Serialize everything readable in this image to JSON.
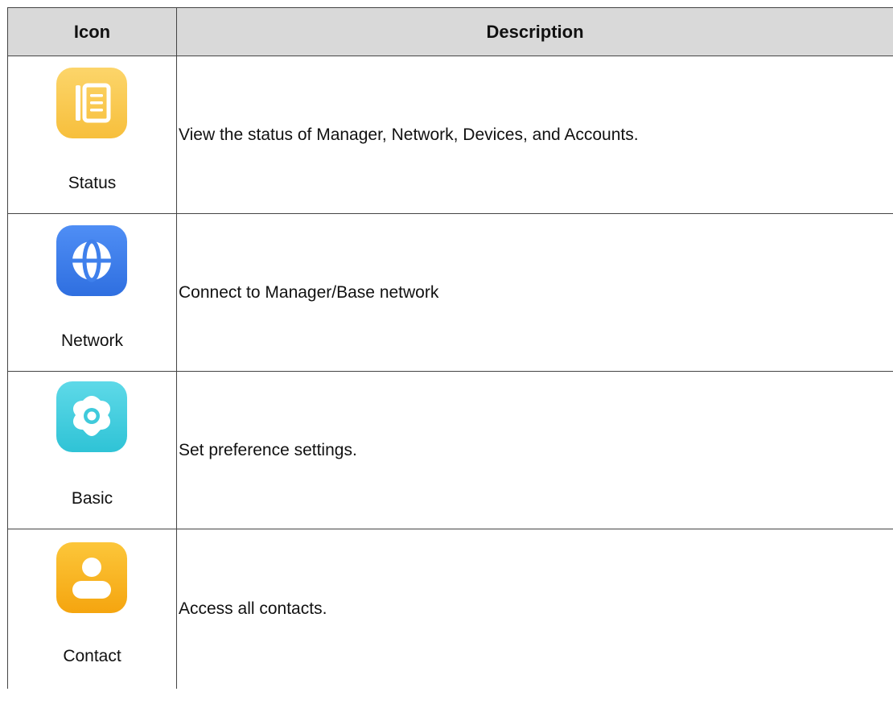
{
  "table": {
    "headers": {
      "icon": "Icon",
      "description": "Description"
    },
    "rows": [
      {
        "icon_name": "status-icon",
        "label": "Status",
        "description": "View the status of Manager, Network, Devices, and Accounts.",
        "color": "#f9c94e"
      },
      {
        "icon_name": "globe-icon",
        "label": "Network",
        "description": "Connect to Manager/Base network",
        "color": "#3d7eea"
      },
      {
        "icon_name": "gear-icon",
        "label": "Basic",
        "description": "Set preference settings.",
        "color": "#45cfdf"
      },
      {
        "icon_name": "person-icon",
        "label": "Contact",
        "description": "Access all contacts.",
        "color": "#f8b624"
      }
    ]
  }
}
